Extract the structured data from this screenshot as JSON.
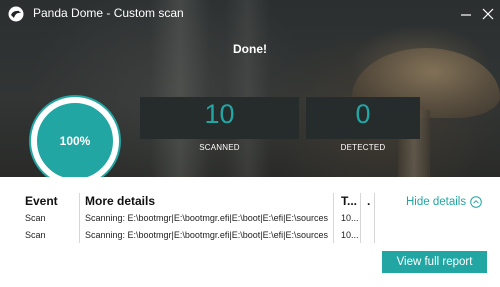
{
  "window": {
    "title": "Panda Dome - Custom scan",
    "minimize_icon": "minimize-icon",
    "close_icon": "close-icon"
  },
  "status": {
    "title": "Done!",
    "progress_label": "100%",
    "progress_fraction": 1.0
  },
  "stats": {
    "scanned": {
      "value": "10",
      "label": "SCANNED"
    },
    "detected": {
      "value": "0",
      "label": "DETECTED"
    }
  },
  "details": {
    "headers": {
      "event": "Event",
      "more_details": "More details",
      "time": "T...",
      "extra": "."
    },
    "rows": [
      {
        "event": "Scan",
        "details": "Scanning: E:\\bootmgr|E:\\bootmgr.efi|E:\\boot|E:\\efi|E:\\sources",
        "time": "10..."
      },
      {
        "event": "Scan",
        "details": "Scanning: E:\\bootmgr|E:\\bootmgr.efi|E:\\boot|E:\\efi|E:\\sources",
        "time": "10..."
      }
    ],
    "hide_label": "Hide details"
  },
  "actions": {
    "view_report": "View full report"
  },
  "colors": {
    "accent": "#22a6a3",
    "ring": "#ffffff",
    "stat_bg": "#262b2c"
  }
}
